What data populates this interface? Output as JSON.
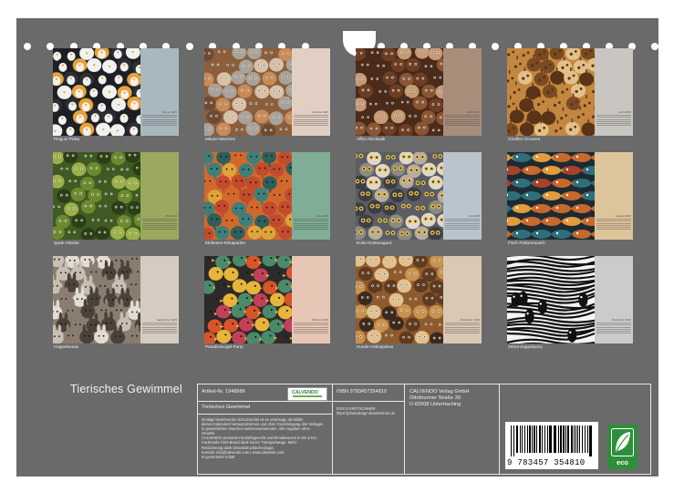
{
  "months": [
    {
      "caption": "Pinguin-Polka",
      "cal_title": "Januar 2026",
      "panel_color": "#a9b8bf",
      "pattern": "penguin"
    },
    {
      "caption": "Mäuse-Märchen",
      "cal_title": "Februar 2026",
      "panel_color": "#e0cfc2",
      "pattern": "mouse"
    },
    {
      "caption": "Affen-Akrobatik",
      "cal_title": "März 2026",
      "panel_color": "#a88d7b",
      "pattern": "monkey"
    },
    {
      "caption": "Giraffen-Grooves",
      "cal_title": "April 2026",
      "panel_color": "#c9c6c1",
      "pattern": "giraffe"
    },
    {
      "caption": "Quak-Attacke",
      "cal_title": "Mai 2026",
      "panel_color": "#9aa95f",
      "pattern": "frog"
    },
    {
      "caption": "Elefanten-Eskapaden",
      "cal_title": "Juni 2026",
      "panel_color": "#80ad96",
      "pattern": "elephant"
    },
    {
      "caption": "Eulen-Extravaganz",
      "cal_title": "Juli 2026",
      "panel_color": "#b9c4cc",
      "pattern": "owl"
    },
    {
      "caption": "Fisch-Farbenrausch",
      "cal_title": "August 2026",
      "panel_color": "#dcc49b",
      "pattern": "fish"
    },
    {
      "caption": "Hoppelmania",
      "cal_title": "September 2026",
      "panel_color": "#d6cbc0",
      "pattern": "rabbit"
    },
    {
      "caption": "Paradiesvogel-Party",
      "cal_title": "Oktober 2026",
      "panel_color": "#e7c6b6",
      "pattern": "bird"
    },
    {
      "caption": "Hunde-Hokuspokus",
      "cal_title": "November 2026",
      "panel_color": "#d9c8b4",
      "pattern": "dog"
    },
    {
      "caption": "Zebra-Zappelparty",
      "cal_title": "Dezember 2026",
      "panel_color": "#cbcbcb",
      "pattern": "zebra"
    }
  ],
  "footer": {
    "title": "Tierisches Gewimmel",
    "article_no": "Artikel-Nr. 1948986",
    "product_title": "Tierisches Gewimmel",
    "logo_text": "CALVENDO",
    "isbn": "ISBN 9783457354810",
    "author": "ERICH KRÄTSCHMER",
    "author_url": "https://photodesign-kraetschmer.de",
    "publisher_lines": [
      "CALVENDO Verlag GmbH",
      "Ottobrunner Straße 39",
      "D-82008 Unterhaching"
    ],
    "legal_lines": [
      "Inhalige bestehender Schutzrechte ist es untersagt, die Bilder",
      "dieses Kalenders herauszutrennen und ohne Genehmigung des Verlages",
      "in gewerblichen Zwecken weiterzuverwenden. Alle Angaben ohne",
      "Gewähr.",
      "CALVENDO-produziert bedarfsgerecht und klimabewusst in DE & EU.",
      "Fachmarkt CDD-Brand dank kurzer Transportwege. Mehr:",
      "Reduzierung dank Einsatzdrucktechnologie.",
      "Kontakt: info@calvendo.com | www.calvendo.com",
      "KI-generierter Inhalt"
    ],
    "barcode_text": "9 783457 354810",
    "eco_label": "eco"
  },
  "colors": {
    "sheet": "#6a6a6a",
    "line": "#e6e6e6"
  }
}
